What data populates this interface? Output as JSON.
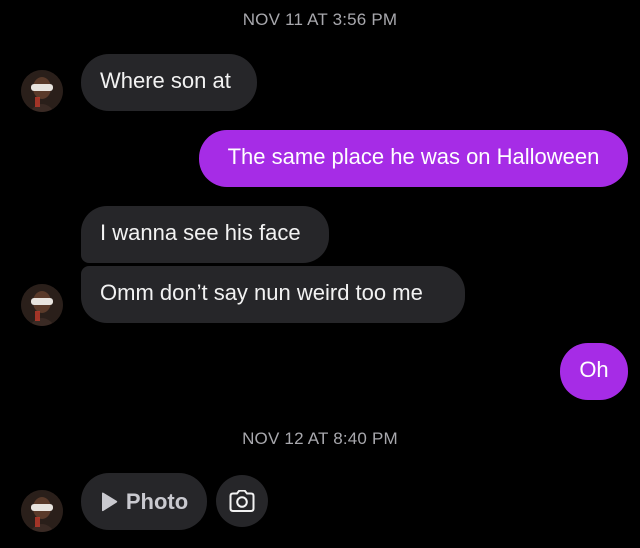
{
  "conversation": {
    "timestamps": [
      "NOV 11 AT 3:56 PM",
      "NOV 12 AT 8:40 PM"
    ],
    "messages": [
      {
        "sender": "them",
        "text": "Where son at"
      },
      {
        "sender": "me",
        "text": "The same place he was on Halloween"
      },
      {
        "sender": "them",
        "text": "I wanna see his face"
      },
      {
        "sender": "them",
        "text": "Omm don’t say nun weird too me"
      },
      {
        "sender": "me",
        "text": "Oh"
      }
    ],
    "attachment": {
      "label": "Photo",
      "icon": "play-icon"
    },
    "camera": {
      "icon": "camera-icon"
    }
  },
  "colors": {
    "background": "#000000",
    "incoming_bubble": "#262629",
    "outgoing_bubble": "#a62ce6",
    "timestamp_text": "#a8a8ad"
  }
}
